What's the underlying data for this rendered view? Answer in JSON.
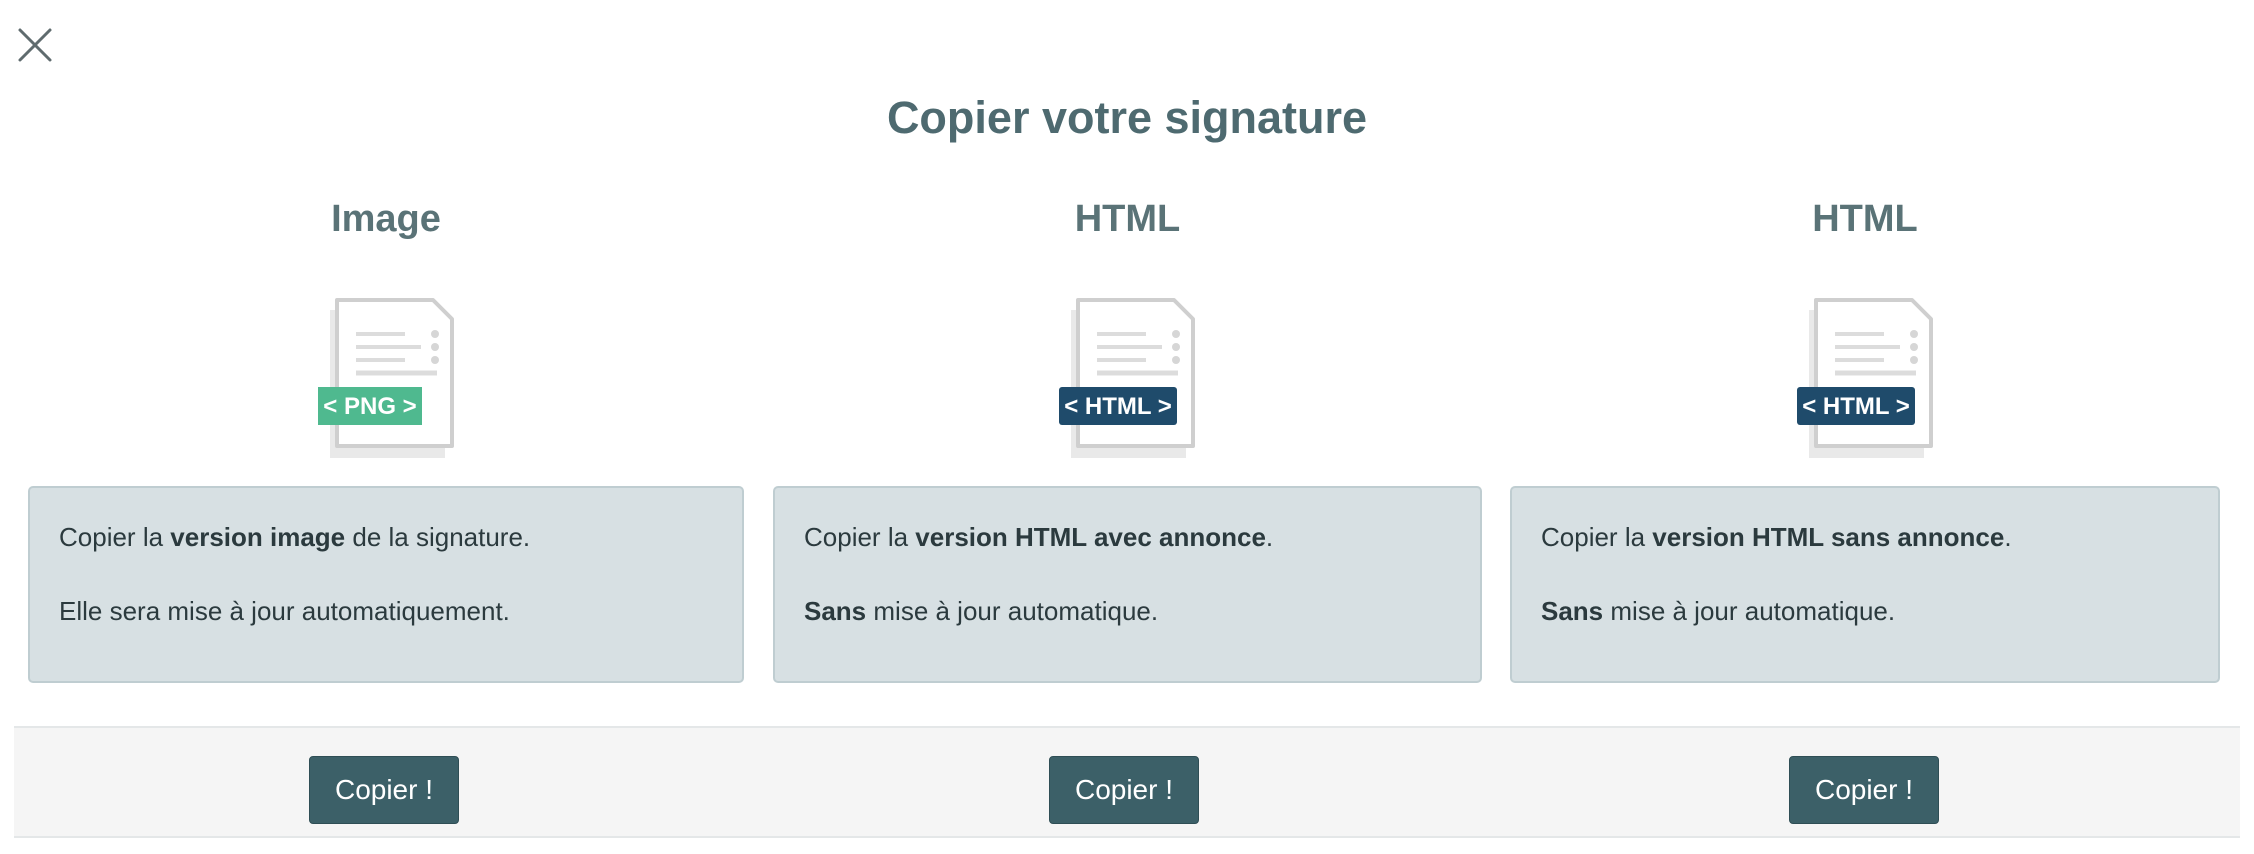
{
  "modal": {
    "title": "Copier votre signature"
  },
  "colors": {
    "accent": "#3c6068",
    "heading": "#4e6a70",
    "card_bg": "#d7e0e3",
    "png_badge": "#4fb98f",
    "html_badge": "#1f4b6b"
  },
  "columns": [
    {
      "heading": "Image",
      "icon": "png-file-icon",
      "badge": "PNG",
      "line1_pre": "Copier la ",
      "line1_bold": "version image",
      "line1_post": " de la signature.",
      "line2_bold": "",
      "line2_post": "Elle sera mise à jour automatiquement.",
      "button": "Copier !"
    },
    {
      "heading": "HTML",
      "icon": "html-file-icon",
      "badge": "HTML",
      "line1_pre": "Copier la ",
      "line1_bold": "version HTML avec annonce",
      "line1_post": ".",
      "line2_bold": "Sans",
      "line2_post": " mise à jour automatique.",
      "button": "Copier !"
    },
    {
      "heading": "HTML",
      "icon": "html-file-icon",
      "badge": "HTML",
      "line1_pre": "Copier la ",
      "line1_bold": "version HTML sans annonce",
      "line1_post": ".",
      "line2_bold": "Sans",
      "line2_post": " mise à jour automatique.",
      "button": "Copier !"
    }
  ]
}
